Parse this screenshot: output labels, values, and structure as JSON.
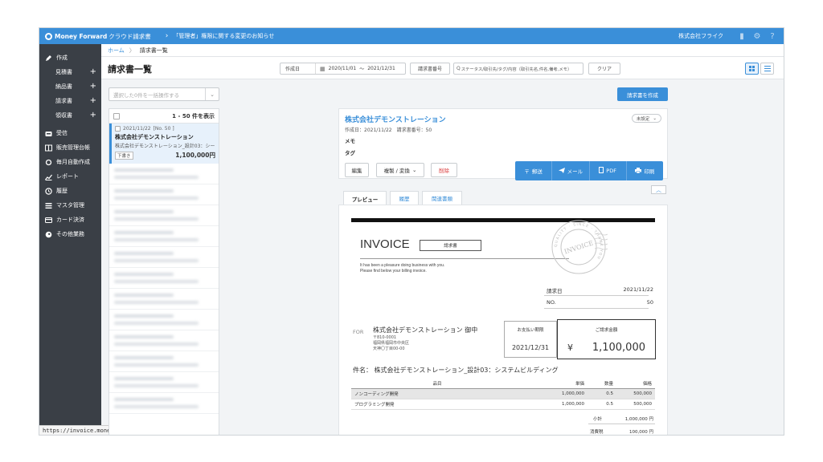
{
  "topbar": {
    "logo_main": "Money Forward",
    "logo_sub": "クラウド請求書",
    "notice": "「管理者」権限に関する変更のお知らせ",
    "company": "株式会社フライク"
  },
  "sidebar": {
    "create_label": "作成",
    "create_items": [
      {
        "label": "見積書"
      },
      {
        "label": "納品書"
      },
      {
        "label": "請求書"
      },
      {
        "label": "領収書"
      }
    ],
    "nav_items": [
      {
        "label": "受信"
      },
      {
        "label": "販売管理台帳"
      },
      {
        "label": "毎月自動作成"
      },
      {
        "label": "レポート"
      },
      {
        "label": "履歴"
      },
      {
        "label": "マスタ管理"
      },
      {
        "label": "カード決済"
      },
      {
        "label": "その他業務"
      }
    ]
  },
  "status_url": "https://invoice.moneyfo",
  "breadcrumb": {
    "home": "ホーム",
    "current": "請求書一覧"
  },
  "header": {
    "title": "請求書一覧",
    "date_type": "作成日",
    "date_from": "2020/11/01",
    "date_sep": "〜",
    "date_to": "2021/12/31",
    "invoice_no_btn": "請求書番号",
    "search_placeholder": "ステータス/取引先/タグ/内容（取引先名,件名,備考,メモ）",
    "clear_btn": "クリア"
  },
  "bulk_select": "選択した0件を一括操作する",
  "create_btn": "請求書を作成",
  "list": {
    "count_label": "1 - 50 件を表示",
    "selected": {
      "date": "2021/11/22",
      "no": "[No. 50 ]",
      "name": "株式会社デモンストレーション",
      "desc": "株式会社デモンストレーション_設計03：シー",
      "badge": "下書き",
      "amount": "1,100,000円"
    }
  },
  "detail": {
    "name": "株式会社デモンストレーション",
    "meta": "作成日：2021/11/22　請求書番号：50",
    "memo_label": "メモ",
    "tag_label": "タグ",
    "status": "未設定",
    "edit_btn": "編集",
    "copy_btn": "複製 / 変換",
    "delete_btn": "削除",
    "send_buttons": [
      "郵送",
      "メール",
      "PDF",
      "印刷"
    ]
  },
  "tabs": [
    "プレビュー",
    "履歴",
    "関連書類"
  ],
  "invoice": {
    "title": "INVOICE",
    "doc_type": "請求書",
    "message_line1": "It has been a pleasure doing business with you.",
    "message_line2": "Please find below your billing invoice.",
    "stamp_text": "INVOICE",
    "stamp_ring": "QUALITY · SINCE · THANK YOU",
    "date_label": "請求日",
    "date_value": "2021/11/22",
    "no_label": "NO.",
    "no_value": "50",
    "for_label": "FOR",
    "client_name": "株式会社デモンストレーション 御中",
    "addr_line1": "〒810-0001",
    "addr_line2": "福岡県福岡市中央区",
    "addr_line3": "天神〇丁目00-00",
    "due_label": "お支払い期限",
    "due_value": "2021/12/31",
    "amount_label": "ご請求金額",
    "yen": "¥",
    "amount_value": "1,100,000",
    "subject": "件名： 株式会社デモンストレーション_設計03：システムビルディング",
    "table_headers": [
      "品目",
      "単価",
      "数量",
      "価格"
    ],
    "rows": [
      {
        "item": "ノンコーディング開発",
        "price": "1,000,000",
        "qty": "0.5",
        "amount": "500,000"
      },
      {
        "item": "プログラミング開発",
        "price": "1,000,000",
        "qty": "0.5",
        "amount": "500,000"
      }
    ],
    "subtotal_label": "小計",
    "subtotal_value": "1,000,000 円",
    "tax_label": "消費税",
    "tax_value": "100,000 円"
  }
}
